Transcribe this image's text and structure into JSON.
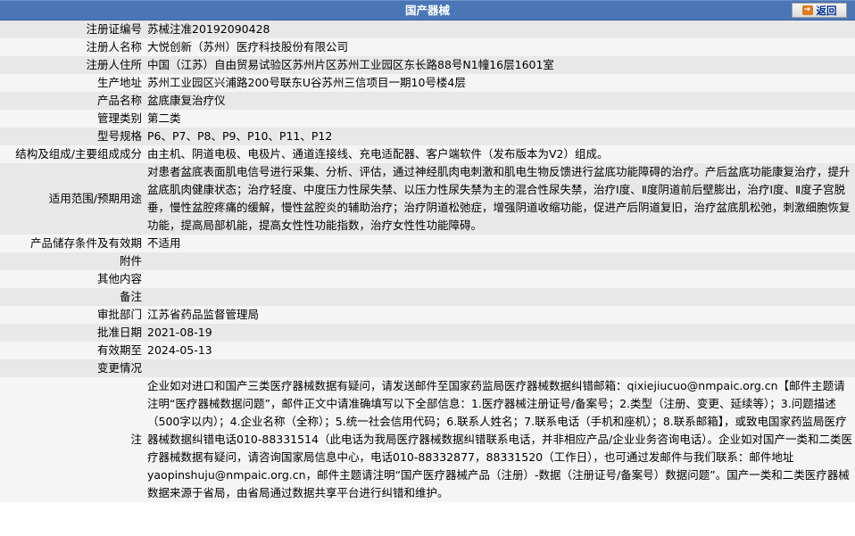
{
  "header": {
    "title": "国产器械",
    "back_label": "返回"
  },
  "rows": [
    {
      "label": "注册证编号",
      "value": "苏械注准20192090428"
    },
    {
      "label": "注册人名称",
      "value": "大悦创新（苏州）医疗科技股份有限公司"
    },
    {
      "label": "注册人住所",
      "value": "中国（江苏）自由贸易试验区苏州片区苏州工业园区东长路88号N1幢16层1601室"
    },
    {
      "label": "生产地址",
      "value": "苏州工业园区兴浦路200号联东U谷苏州三信项目一期10号楼4层"
    },
    {
      "label": "产品名称",
      "value": "盆底康复治疗仪"
    },
    {
      "label": "管理类别",
      "value": "第二类"
    },
    {
      "label": "型号规格",
      "value": "P6、P7、P8、P9、P10、P11、P12"
    },
    {
      "label": "结构及组成/主要组成成分",
      "value": "由主机、阴道电极、电极片、通道连接线、充电适配器、客户端软件（发布版本为V2）组成。"
    },
    {
      "label": "适用范围/预期用途",
      "value": "对患者盆底表面肌电信号进行采集、分析、评估，通过神经肌肉电刺激和肌电生物反馈进行盆底功能障碍的治疗。产后盆底功能康复治疗，提升盆底肌肉健康状态；治疗轻度、中度压力性尿失禁、以压力性尿失禁为主的混合性尿失禁，治疗Ⅰ度、Ⅱ度阴道前后壁膨出，治疗Ⅰ度、Ⅱ度子宫脱垂，慢性盆腔疼痛的缓解，慢性盆腔炎的辅助治疗；治疗阴道松弛症，增强阴道收缩功能，促进产后阴道复旧，治疗盆底肌松弛，刺激细胞恢复功能，提高局部机能，提高女性性功能指数，治疗女性性功能障碍。"
    },
    {
      "label": "产品储存条件及有效期",
      "value": "不适用"
    },
    {
      "label": "附件",
      "value": ""
    },
    {
      "label": "其他内容",
      "value": ""
    },
    {
      "label": "备注",
      "value": ""
    },
    {
      "label": "审批部门",
      "value": "江苏省药品监督管理局"
    },
    {
      "label": "批准日期",
      "value": "2021-08-19"
    },
    {
      "label": "有效期至",
      "value": "2024-05-13"
    },
    {
      "label": "变更情况",
      "value": ""
    }
  ],
  "note": {
    "label": "注",
    "text": "企业如对进口和国产三类医疗器械数据有疑问，请发送邮件至国家药监局医疗器械数据纠错邮箱：qixiejiucuo@nmpaic.org.cn【邮件主题请注明“医疗器械数据问题”，邮件正文中请准确填写以下全部信息：1.医疗器械注册证号/备案号；2.类型（注册、变更、延续等）；3.问题描述（500字以内）；4.企业名称（全称）；5.统一社会信用代码；6.联系人姓名；7.联系电话（手机和座机）；8.联系邮箱】，或致电国家药监局医疗器械数据纠错电话010-88331514（此电话为我局医疗器械数据纠错联系电话，并非相应产品/企业业务咨询电话）。企业如对国产一类和二类医疗器械数据有疑问，请咨询国家局信息中心，电话010-88332877，88331520（工作日），也可通过发邮件与我们联系：邮件地址yaopinshuju@nmpaic.org.cn，邮件主题请注明“国产医疗器械产品（注册）-数据（注册证号/备案号）数据问题”。国产一类和二类医疗器械数据来源于省局，由省局通过数据共享平台进行纠错和维护。"
  }
}
